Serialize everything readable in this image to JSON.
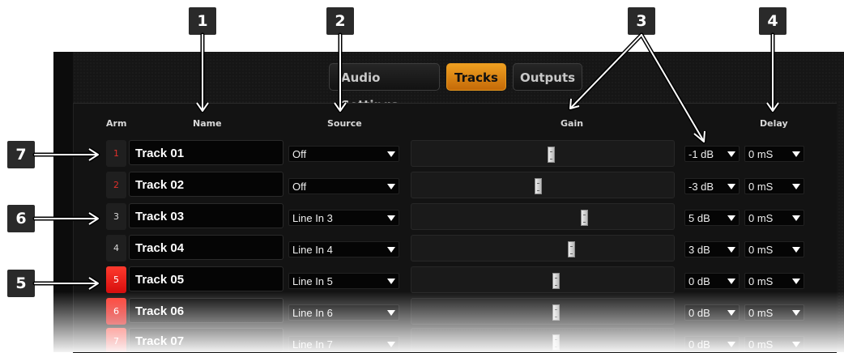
{
  "tabs": [
    "Audio Settings",
    "Tracks",
    "Outputs"
  ],
  "headers": {
    "arm": "Arm",
    "name": "Name",
    "source": "Source",
    "gain": "Gain",
    "delay": "Delay"
  },
  "callouts": [
    "1",
    "2",
    "3",
    "4",
    "5",
    "6",
    "7"
  ],
  "rows": [
    {
      "arm": "1",
      "name": "Track 01",
      "source": "Off",
      "gain": "-1 dB",
      "delay": "0 mS",
      "gain_level": 0.53
    },
    {
      "arm": "2",
      "name": "Track 02",
      "source": "Off",
      "gain": "-3 dB",
      "delay": "0 mS",
      "gain_level": 0.48
    },
    {
      "arm": "3",
      "name": "Track 03",
      "source": "Line In 3",
      "gain": "5 dB",
      "delay": "0 mS",
      "gain_level": 0.66
    },
    {
      "arm": "4",
      "name": "Track 04",
      "source": "Line In 4",
      "gain": "3 dB",
      "delay": "0 mS",
      "gain_level": 0.61
    },
    {
      "arm": "5",
      "name": "Track 05",
      "source": "Line In 5",
      "gain": "0 dB",
      "delay": "0 mS",
      "gain_level": 0.55
    },
    {
      "arm": "6",
      "name": "Track 06",
      "source": "Line In 6",
      "gain": "0 dB",
      "delay": "0 mS",
      "gain_level": 0.55
    },
    {
      "arm": "7",
      "name": "Track 07",
      "source": "Line In 7",
      "gain": "0 dB",
      "delay": "0 mS",
      "gain_level": 0.55
    }
  ],
  "colors": {
    "accent": "#e68a12",
    "armed": "#e8140f",
    "arm_number_red": "#e0302b"
  }
}
